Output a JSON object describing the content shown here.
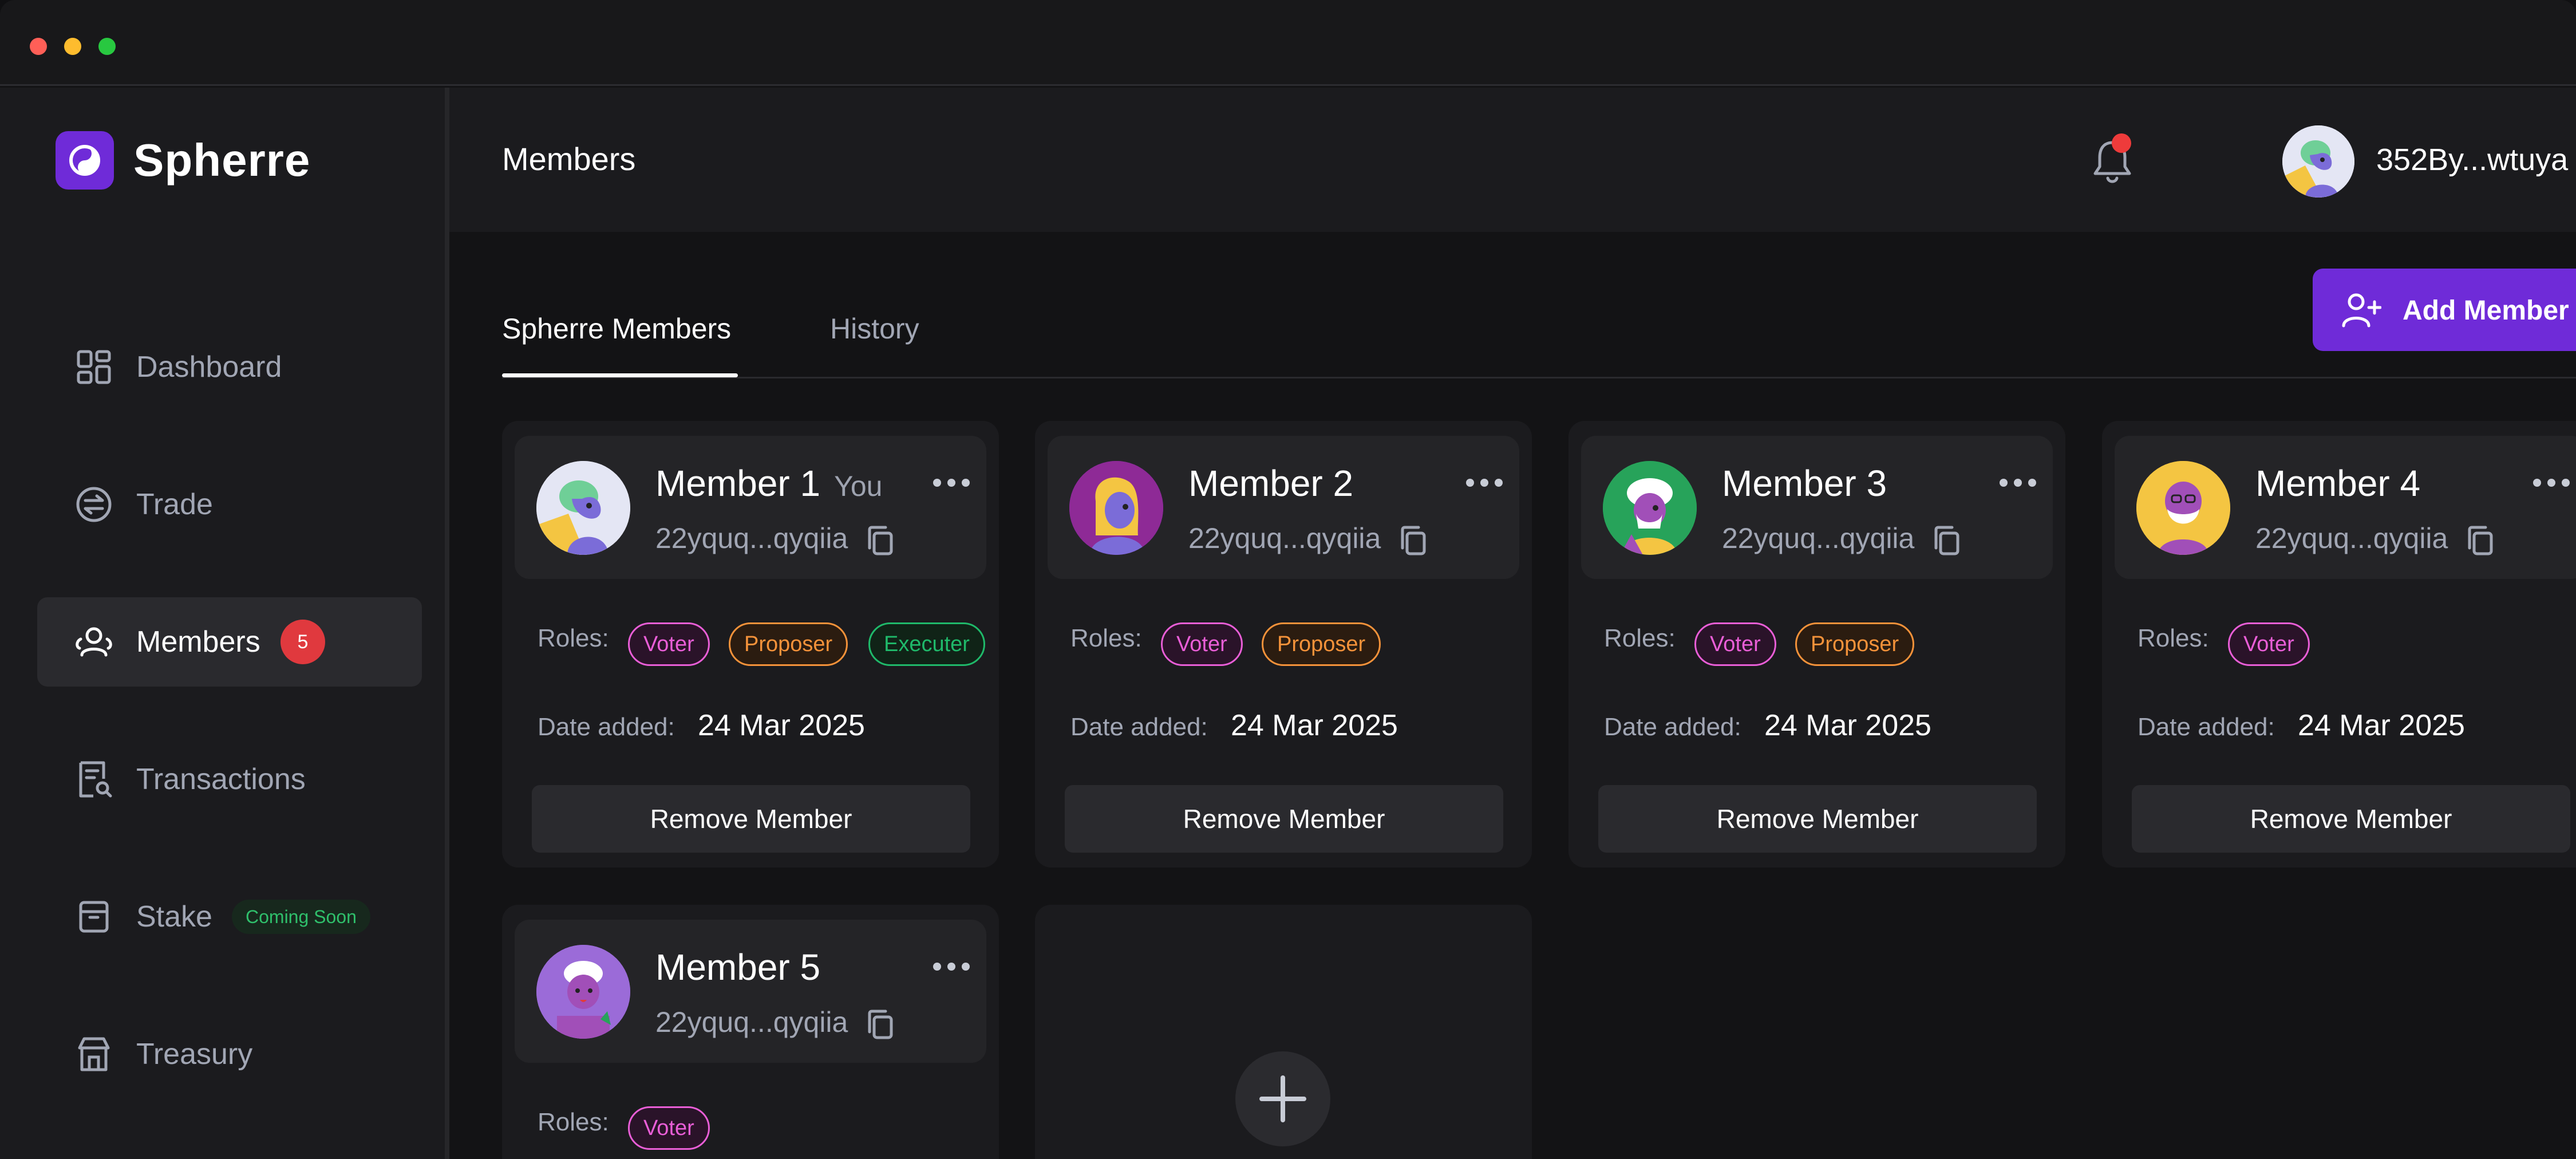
{
  "app": {
    "name": "Spherre"
  },
  "colors": {
    "accent": "#6f2bd8",
    "danger_badge": "#e0393e",
    "voter": "#e95ed7",
    "proposer": "#f4923a",
    "executer": "#1fb96a",
    "coming_soon": "#2fbf6b"
  },
  "sidebar": {
    "items": [
      {
        "label": "Dashboard",
        "icon": "dashboard-icon"
      },
      {
        "label": "Trade",
        "icon": "trade-icon"
      },
      {
        "label": "Members",
        "icon": "members-icon",
        "badge": "5",
        "active": true
      },
      {
        "label": "Transactions",
        "icon": "transactions-icon"
      },
      {
        "label": "Stake",
        "icon": "stake-icon",
        "tag": "Coming Soon"
      },
      {
        "label": "Treasury",
        "icon": "treasury-icon"
      }
    ]
  },
  "header": {
    "title": "Members",
    "user_address": "352By...wtuya"
  },
  "tabs": [
    {
      "label": "Spherre Members",
      "active": true
    },
    {
      "label": "History",
      "active": false
    }
  ],
  "add_member_button": "Add Member",
  "card_labels": {
    "roles": "Roles:",
    "date_added": "Date added:",
    "remove": "Remove Member",
    "you": "You"
  },
  "members": [
    {
      "name": "Member 1",
      "is_you": true,
      "address": "22yquq...qyqiia",
      "roles": [
        "Voter",
        "Proposer",
        "Executer"
      ],
      "date": "24 Mar 2025"
    },
    {
      "name": "Member 2",
      "address": "22yquq...qyqiia",
      "roles": [
        "Voter",
        "Proposer"
      ],
      "date": "24 Mar 2025"
    },
    {
      "name": "Member 3",
      "address": "22yquq...qyqiia",
      "roles": [
        "Voter",
        "Proposer"
      ],
      "date": "24 Mar 2025"
    },
    {
      "name": "Member 4",
      "address": "22yquq...qyqiia",
      "roles": [
        "Voter"
      ],
      "date": "24 Mar 2025"
    },
    {
      "name": "Member 5",
      "address": "22yquq...qyqiia",
      "roles": [
        "Voter"
      ]
    }
  ]
}
